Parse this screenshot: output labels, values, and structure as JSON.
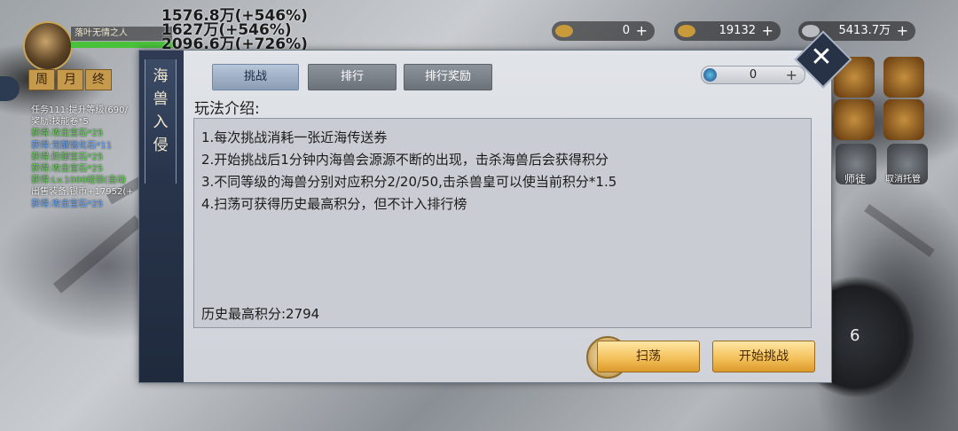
{
  "hud": {
    "power_lines": [
      "1576.8万(+546%)",
      "1627万(+546%)",
      "2096.6万(+726%)"
    ],
    "player_name": "落叶无情之人",
    "calendar_tabs": [
      "周",
      "月",
      "终"
    ],
    "quest_lines": [
      {
        "text": "任务111:提升等级(690/",
        "color": "normal"
      },
      {
        "text": "奖励:技能卷*5",
        "color": "normal"
      },
      {
        "text": "获得:攻击宝石*25",
        "color": "green"
      },
      {
        "text": "获得:觉醒强化石*11",
        "color": "blue"
      },
      {
        "text": "获得:防御宝石*25",
        "color": "green"
      },
      {
        "text": "获得:攻击宝石*25",
        "color": "green"
      },
      {
        "text": "获得:Lv.1000经验(自动",
        "color": "green"
      },
      {
        "text": "出售装备,银币+17952(+",
        "color": "normal"
      },
      {
        "text": "获得:攻击宝石*25",
        "color": "blue"
      }
    ],
    "resources": [
      {
        "value": "0",
        "plus": "+"
      },
      {
        "value": "19132",
        "plus": "+"
      },
      {
        "value": "5413.7万",
        "plus": "+"
      }
    ],
    "right_labels": [
      "师徒",
      "取消托管"
    ],
    "skill_count": "6"
  },
  "dialog": {
    "title_chars": [
      "海",
      "兽",
      "入",
      "侵"
    ],
    "tabs": [
      {
        "label": "挑战",
        "active": true
      },
      {
        "label": "排行",
        "active": false
      },
      {
        "label": "排行奖励",
        "active": false
      }
    ],
    "counter": {
      "value": "0",
      "plus": "+"
    },
    "intro_label": "玩法介绍:",
    "rules": [
      "1.每次挑战消耗一张近海传送券",
      "2.开始挑战后1分钟内海兽会源源不断的出现，击杀海兽后会获得积分",
      "3.不同等级的海兽分别对应积分2/20/50,击杀兽皇可以使当前积分*1.5",
      "4.扫荡可获得历史最高积分，但不计入排行榜"
    ],
    "best_score": "历史最高积分:2794",
    "sweep_button": "扫荡",
    "start_button": "开始挑战",
    "close": "✕"
  }
}
